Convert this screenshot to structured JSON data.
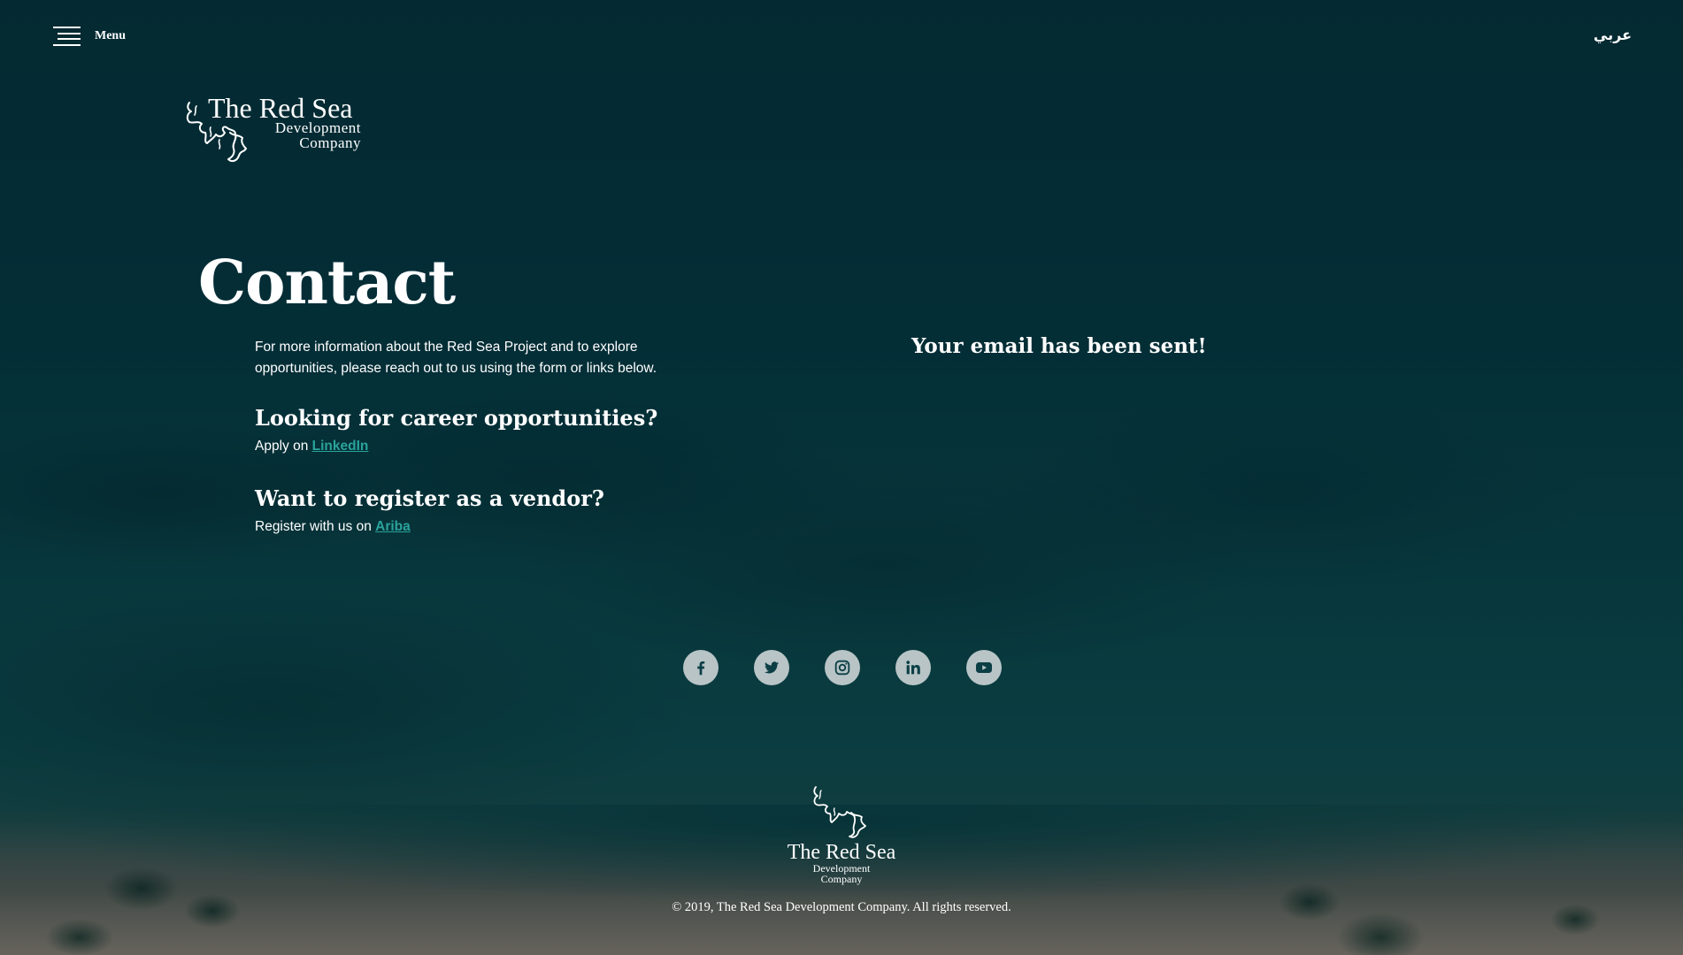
{
  "header": {
    "menu_label": "Menu",
    "language_label": "عربي"
  },
  "logo": {
    "line1": "The Red Sea",
    "line2": "Development",
    "line3": "Company"
  },
  "contact": {
    "title": "Contact",
    "intro": "For more information about the Red Sea Project and to explore opportunities, please reach out to us using the form or links below.",
    "career_heading": "Looking for career opportunities?",
    "career_text": "Apply on",
    "career_link": "LinkedIn",
    "vendor_heading": "Want to register as a vendor?",
    "vendor_text": "Register with us on",
    "vendor_link": "Ariba"
  },
  "form": {
    "sent_message": "Your email has been sent!"
  },
  "social": [
    "facebook-icon",
    "twitter-icon",
    "instagram-icon",
    "linkedin-icon",
    "youtube-icon"
  ],
  "footer": {
    "copyright": "© 2019, The Red Sea Development Company. All rights reserved."
  },
  "colors": {
    "background": "#04303a",
    "link": "#2aa39b",
    "social_icon_bg": "#b8c4c6"
  }
}
